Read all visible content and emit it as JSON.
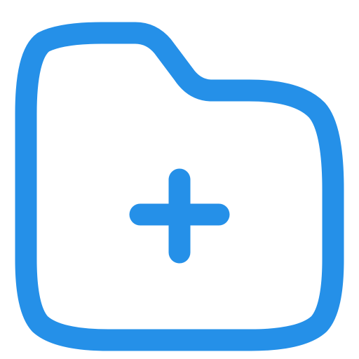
{
  "icon": {
    "name": "folder-plus-icon",
    "stroke_color": "#2590E8",
    "background_color": "#FFFFFF"
  }
}
